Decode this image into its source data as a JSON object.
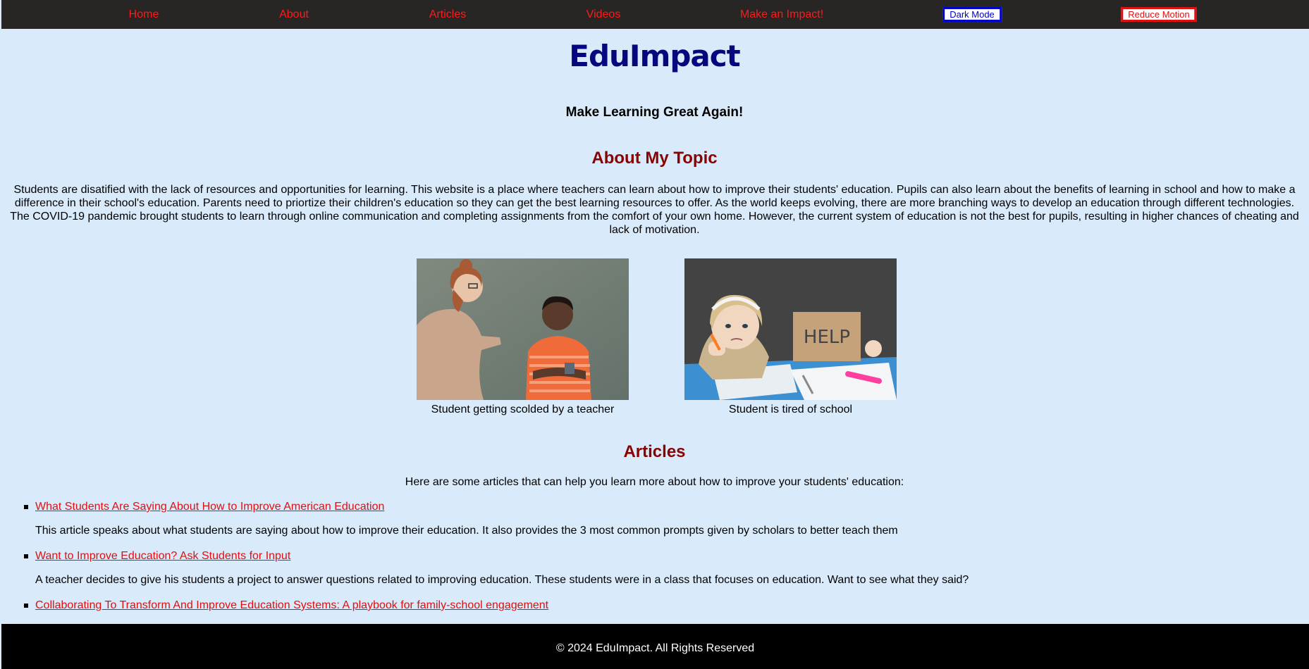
{
  "nav": {
    "links": [
      "Home",
      "About",
      "Articles",
      "Videos",
      "Make an Impact!"
    ],
    "dark_mode_label": "Dark Mode",
    "reduce_motion_label": "Reduce Motion"
  },
  "header": {
    "title": "EduImpact",
    "tagline": "Make Learning Great Again!"
  },
  "about": {
    "heading": "About My Topic",
    "text": "Students are disatified with the lack of resources and opportunities for learning. This website is a place where teachers can learn about how to improve their students' education. Pupils can also learn about the benefits of learning in school and how to make a difference in their school's education. Parents need to priortize their children's education so they can get the best learning resources to offer. As the world keeps evolving, there are more branching ways to develop an education through different technologies. The COVID-19 pandemic brought students to learn through online communication and completing assignments from the comfort of your own home. However, the current system of education is not the best for pupils, resulting in higher chances of cheating and lack of motivation.",
    "images": [
      {
        "caption": "Student getting scolded by a teacher"
      },
      {
        "caption": "Student is tired of school",
        "sign_text": "HELP"
      }
    ]
  },
  "articles": {
    "heading": "Articles",
    "intro": "Here are some articles that can help you learn more about how to improve your students' education:",
    "items": [
      {
        "title": "What Students Are Saying About How to Improve American Education",
        "description": "This article speaks about what students are saying about how to improve their education. It also provides the 3 most common prompts given by scholars to better teach them"
      },
      {
        "title": "Want to Improve Education? Ask Students for Input",
        "description": "A teacher decides to give his students a project to answer questions related to improving education. These students were in a class that focuses on education. Want to see what they said?"
      },
      {
        "title": "Collaborating To Transform And Improve Education Systems: A playbook for family-school engagement",
        "description": ""
      }
    ]
  },
  "footer": {
    "text": "© 2024 EduImpact. All Rights Reserved"
  },
  "colors": {
    "page_bg": "#d9eafa",
    "nav_bg": "#282624",
    "link": "#ff1a1a",
    "title": "#06067e",
    "heading": "#8b0000"
  }
}
